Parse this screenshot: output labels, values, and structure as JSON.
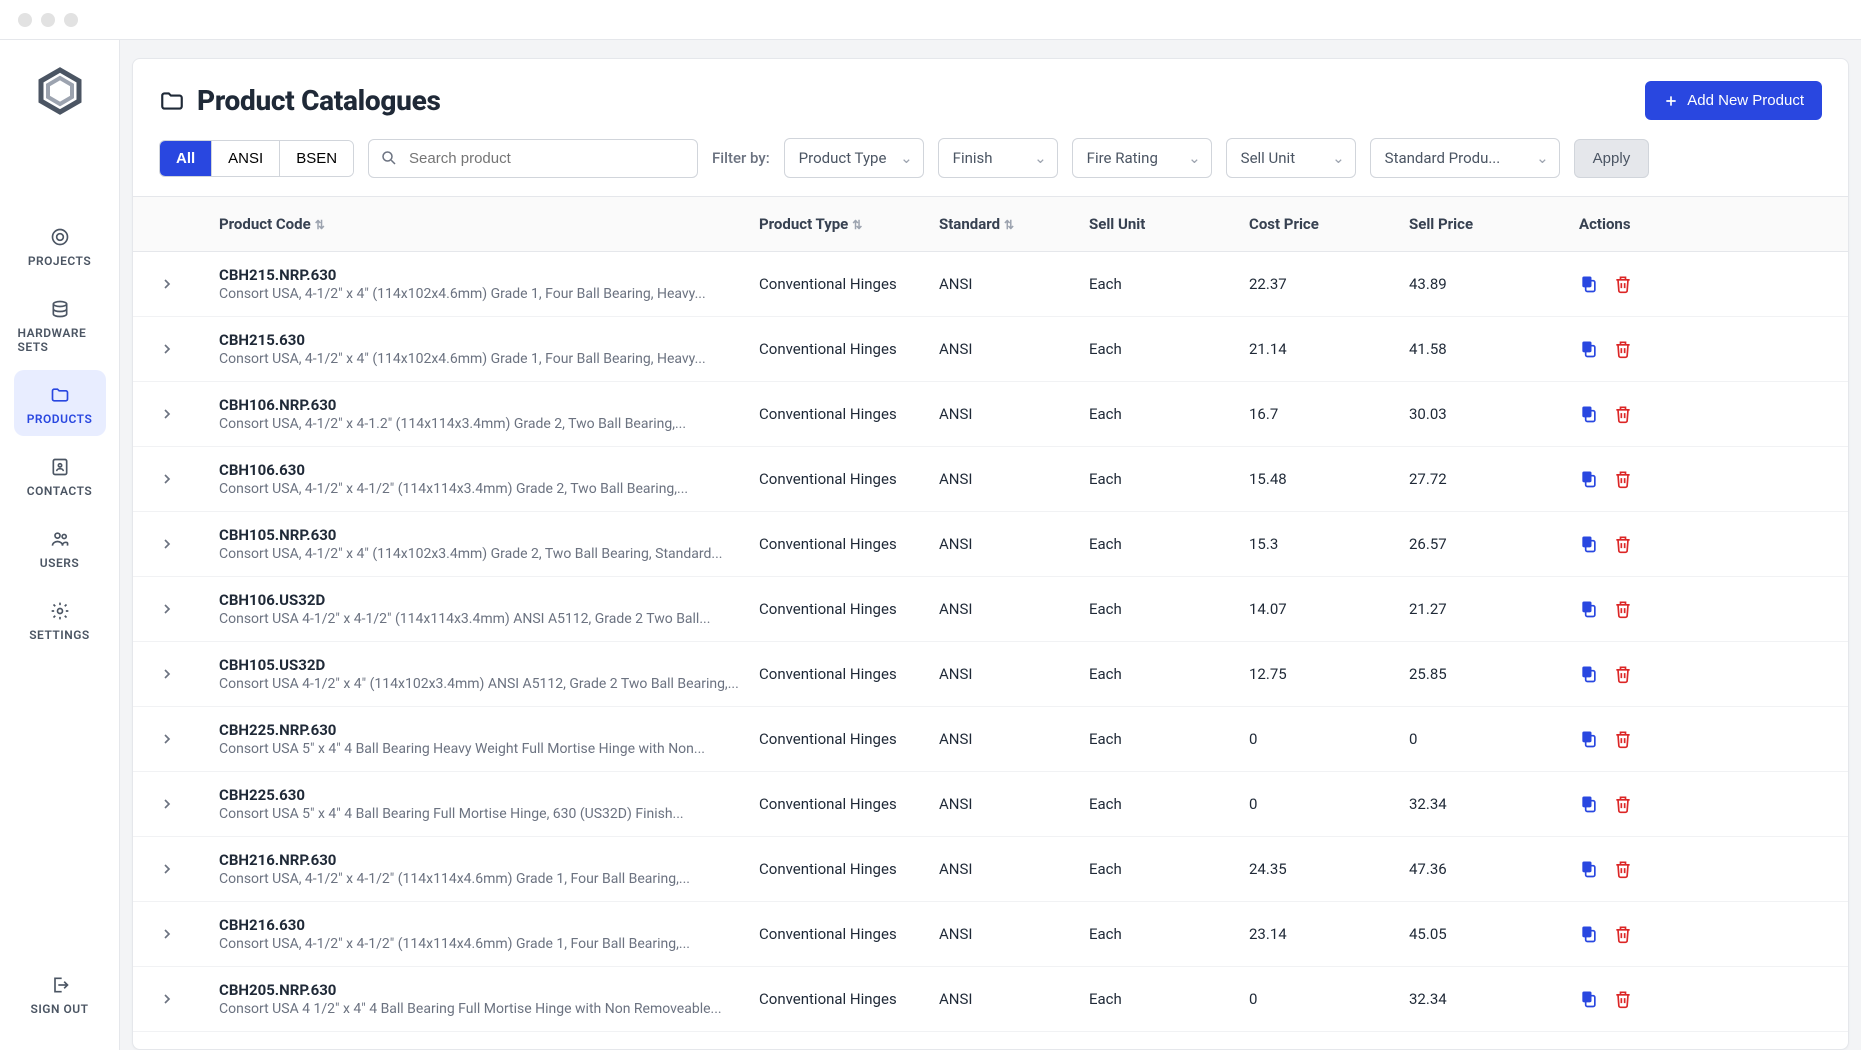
{
  "sidebar": {
    "items": [
      {
        "label": "PROJECTS"
      },
      {
        "label": "HARDWARE SETS"
      },
      {
        "label": "PRODUCTS"
      },
      {
        "label": "CONTACTS"
      },
      {
        "label": "USERS"
      },
      {
        "label": "SETTINGS"
      }
    ],
    "signout": "SIGN OUT"
  },
  "header": {
    "title": "Product Catalogues",
    "add_button": "Add New Product"
  },
  "toolbar": {
    "tabs": [
      "All",
      "ANSI",
      "BSEN"
    ],
    "search_placeholder": "Search product",
    "filter_label": "Filter by:",
    "filters": [
      "Product Type",
      "Finish",
      "Fire Rating",
      "Sell Unit",
      "Standard Produ..."
    ],
    "apply": "Apply"
  },
  "columns": {
    "code": "Product Code",
    "type": "Product Type",
    "standard": "Standard",
    "unit": "Sell Unit",
    "cost": "Cost Price",
    "sell": "Sell Price",
    "actions": "Actions"
  },
  "rows": [
    {
      "code": "CBH215.NRP.630",
      "desc": "Consort USA, 4-1/2\" x 4\" (114x102x4.6mm) Grade 1, Four Ball Bearing, Heavy...",
      "type": "Conventional Hinges",
      "standard": "ANSI",
      "unit": "Each",
      "cost": "22.37",
      "sell": "43.89"
    },
    {
      "code": "CBH215.630",
      "desc": "Consort USA, 4-1/2\" x 4\" (114x102x4.6mm) Grade 1, Four Ball Bearing, Heavy...",
      "type": "Conventional Hinges",
      "standard": "ANSI",
      "unit": "Each",
      "cost": "21.14",
      "sell": "41.58"
    },
    {
      "code": "CBH106.NRP.630",
      "desc": "Consort USA, 4-1/2\" x 4-1.2\" (114x114x3.4mm) Grade 2, Two Ball Bearing,...",
      "type": "Conventional Hinges",
      "standard": "ANSI",
      "unit": "Each",
      "cost": "16.7",
      "sell": "30.03"
    },
    {
      "code": "CBH106.630",
      "desc": "Consort USA, 4-1/2\" x 4-1/2\" (114x114x3.4mm) Grade 2, Two Ball Bearing,...",
      "type": "Conventional Hinges",
      "standard": "ANSI",
      "unit": "Each",
      "cost": "15.48",
      "sell": "27.72"
    },
    {
      "code": "CBH105.NRP.630",
      "desc": "Consort USA, 4-1/2\" x 4\" (114x102x3.4mm) Grade 2, Two Ball Bearing, Standard...",
      "type": "Conventional Hinges",
      "standard": "ANSI",
      "unit": "Each",
      "cost": "15.3",
      "sell": "26.57"
    },
    {
      "code": "CBH106.US32D",
      "desc": "Consort USA 4-1/2\" x 4-1/2\" (114x114x3.4mm) ANSI A5112, Grade 2 Two Ball...",
      "type": "Conventional Hinges",
      "standard": "ANSI",
      "unit": "Each",
      "cost": "14.07",
      "sell": "21.27"
    },
    {
      "code": "CBH105.US32D",
      "desc": "Consort USA 4-1/2\" x 4\" (114x102x3.4mm) ANSI A5112, Grade 2 Two Ball Bearing,...",
      "type": "Conventional Hinges",
      "standard": "ANSI",
      "unit": "Each",
      "cost": "12.75",
      "sell": "25.85"
    },
    {
      "code": "CBH225.NRP.630",
      "desc": "Consort USA 5\" x 4\" 4 Ball Bearing Heavy Weight Full Mortise Hinge with Non...",
      "type": "Conventional Hinges",
      "standard": "ANSI",
      "unit": "Each",
      "cost": "0",
      "sell": "0"
    },
    {
      "code": "CBH225.630",
      "desc": "Consort USA 5\" x 4\" 4 Ball Bearing Full Mortise Hinge, 630 (US32D) Finish...",
      "type": "Conventional Hinges",
      "standard": "ANSI",
      "unit": "Each",
      "cost": "0",
      "sell": "32.34"
    },
    {
      "code": "CBH216.NRP.630",
      "desc": "Consort USA, 4-1/2\" x 4-1/2\" (114x114x4.6mm) Grade 1, Four Ball Bearing,...",
      "type": "Conventional Hinges",
      "standard": "ANSI",
      "unit": "Each",
      "cost": "24.35",
      "sell": "47.36"
    },
    {
      "code": "CBH216.630",
      "desc": "Consort USA, 4-1/2\" x 4-1/2\" (114x114x4.6mm) Grade 1, Four Ball Bearing,...",
      "type": "Conventional Hinges",
      "standard": "ANSI",
      "unit": "Each",
      "cost": "23.14",
      "sell": "45.05"
    },
    {
      "code": "CBH205.NRP.630",
      "desc": "Consort USA 4 1/2\" x 4\" 4 Ball Bearing Full Mortise Hinge with Non Removeable...",
      "type": "Conventional Hinges",
      "standard": "ANSI",
      "unit": "Each",
      "cost": "0",
      "sell": "32.34"
    }
  ]
}
